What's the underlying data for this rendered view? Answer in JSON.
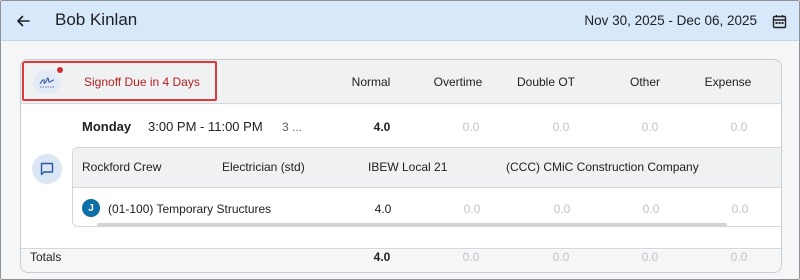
{
  "header": {
    "title": "Bob Kinlan",
    "date_range": "Nov 30, 2025 - Dec 06, 2025",
    "back_icon": "arrow-left-icon",
    "calendar_icon": "calendar-icon"
  },
  "timecard": {
    "signoff_status": "Signoff Due in 4 Days",
    "columns": [
      "Normal",
      "Overtime",
      "Double OT",
      "Other",
      "Expense"
    ],
    "entry": {
      "day": "Monday",
      "time": "3:00 PM - 11:00 PM",
      "extra": "3 ...",
      "values": [
        "4.0",
        "0.0",
        "0.0",
        "0.0",
        "0.0"
      ],
      "details": {
        "crew": "Rockford Crew",
        "trade": "Electrician (std)",
        "union": "IBEW Local 21",
        "company": "(CCC) CMiC Construction Company"
      },
      "job": {
        "badge": "J",
        "label": "(01-100) Temporary Structures",
        "values": [
          "4.0",
          "0.0",
          "0.0",
          "0.0",
          "0.0"
        ]
      }
    },
    "totals": {
      "label": "Totals",
      "values": [
        "4.0",
        "0.0",
        "0.0",
        "0.0",
        "0.0"
      ]
    }
  },
  "colors": {
    "header_bg": "#d7e8fb",
    "signoff_red": "#b72020",
    "highlight_border": "#e0393c",
    "job_badge": "#0b6ea5"
  }
}
